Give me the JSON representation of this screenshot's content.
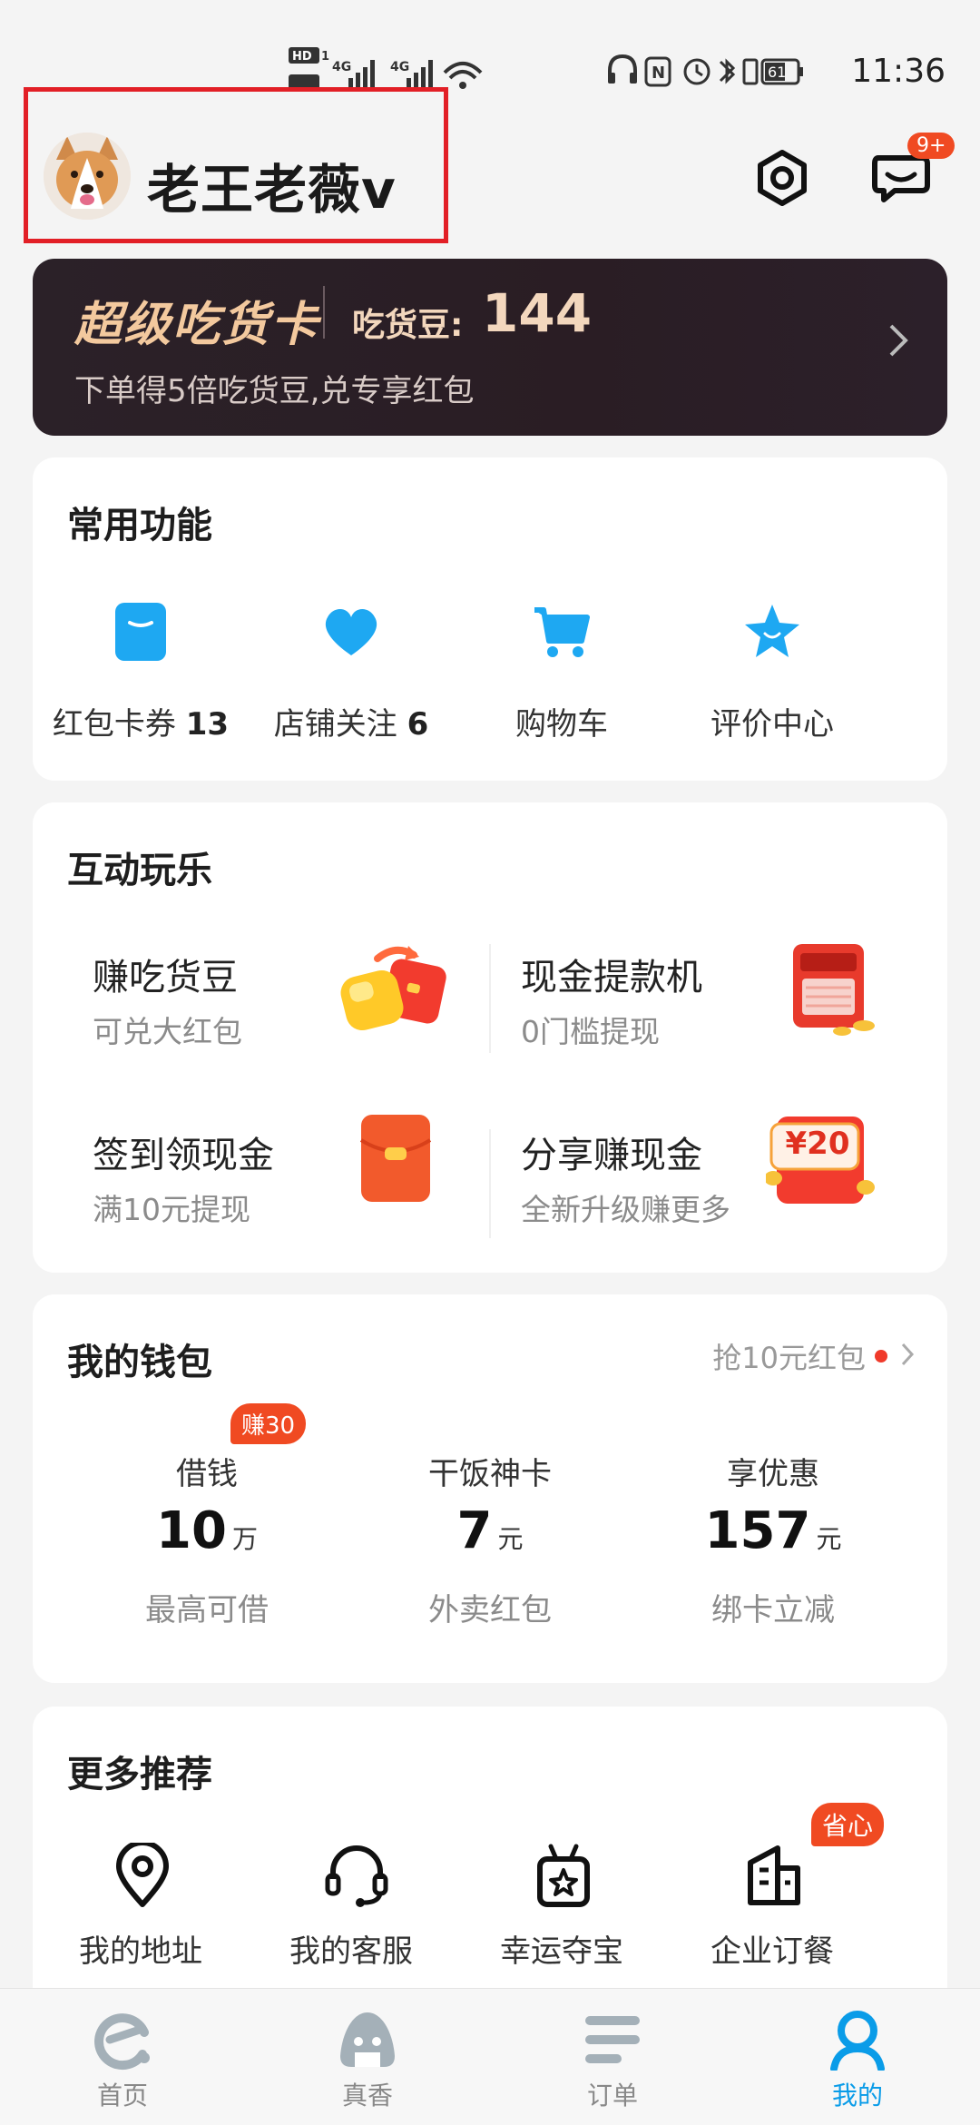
{
  "status_bar": {
    "time": "11:36",
    "battery": "61",
    "network_1": "4G",
    "network_2": "4G",
    "hd": "HD"
  },
  "header": {
    "username": "老王老薇v",
    "message_badge": "9+"
  },
  "banner": {
    "title": "超级吃货卡",
    "bean_label": "吃货豆:",
    "bean_value": "144",
    "subtitle": "下单得5倍吃货豆,兑专享红包"
  },
  "common_functions": {
    "title": "常用功能",
    "items": [
      {
        "label": "红包卡券",
        "count": "13",
        "icon": "coupon-icon"
      },
      {
        "label": "店铺关注",
        "count": "6",
        "icon": "heart-icon"
      },
      {
        "label": "购物车",
        "count": "",
        "icon": "cart-icon"
      },
      {
        "label": "评价中心",
        "count": "",
        "icon": "star-icon"
      }
    ]
  },
  "interactive": {
    "title": "互动玩乐",
    "items": [
      {
        "title": "赚吃货豆",
        "subtitle": "可兑大红包"
      },
      {
        "title": "现金提款机",
        "subtitle": "0门槛提现"
      },
      {
        "title": "签到领现金",
        "subtitle": "满10元提现"
      },
      {
        "title": "分享赚现金",
        "subtitle": "全新升级赚更多",
        "pic_text": "¥20"
      }
    ]
  },
  "wallet": {
    "title": "我的钱包",
    "promo": "抢10元红包",
    "items": [
      {
        "label": "借钱",
        "value": "10",
        "unit": "万",
        "desc": "最高可借",
        "badge": "赚30"
      },
      {
        "label": "干饭神卡",
        "value": "7",
        "unit": "元",
        "desc": "外卖红包"
      },
      {
        "label": "享优惠",
        "value": "157",
        "unit": "元",
        "desc": "绑卡立减"
      }
    ]
  },
  "more": {
    "title": "更多推荐",
    "items": [
      {
        "label": "我的地址",
        "icon": "location-icon"
      },
      {
        "label": "我的客服",
        "icon": "headset-icon"
      },
      {
        "label": "幸运夺宝",
        "icon": "gift-icon"
      },
      {
        "label": "企业订餐",
        "icon": "building-icon",
        "badge": "省心"
      }
    ]
  },
  "bottom_nav": {
    "items": [
      {
        "label": "首页",
        "icon": "home-icon",
        "active": false
      },
      {
        "label": "真香",
        "icon": "onigiri-icon",
        "active": false
      },
      {
        "label": "订单",
        "icon": "orders-icon",
        "active": false
      },
      {
        "label": "我的",
        "icon": "profile-icon",
        "active": true
      }
    ]
  },
  "colors": {
    "accent_blue": "#0a9ce8",
    "highlight_red": "#e21f26",
    "banner_gold": "#f3c99e",
    "badge_orange": "#f04a22"
  }
}
